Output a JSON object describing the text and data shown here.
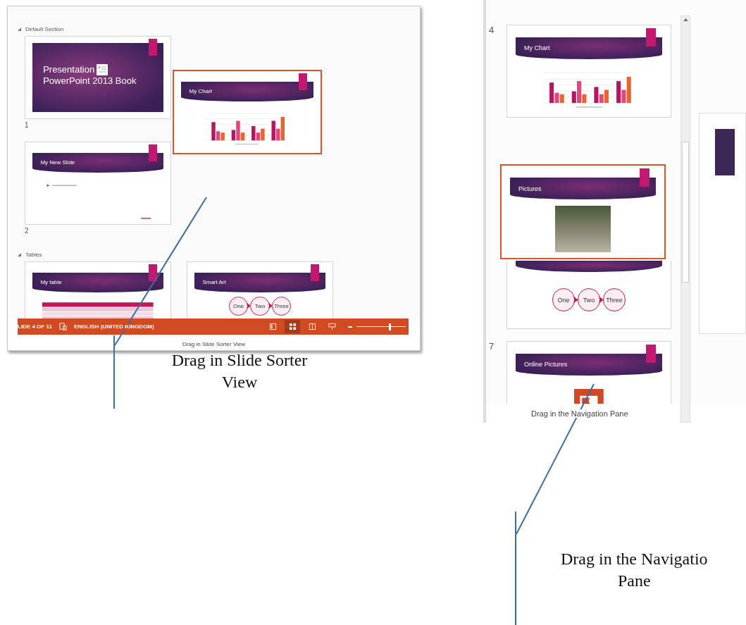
{
  "slide_sorter": {
    "sections": [
      {
        "label": "Default Section",
        "expanded": true,
        "slides": [
          {
            "number": "1",
            "kind": "title",
            "title_lines": [
              "Presentation",
              "PowerPoint 2013 Book"
            ]
          },
          {
            "number": "2",
            "kind": "bullets",
            "title": "My New Slide"
          }
        ]
      },
      {
        "label": "Tables",
        "expanded": true,
        "slides": [
          {
            "kind": "table",
            "title": "My table"
          },
          {
            "kind": "smartart",
            "title": "Smart Art",
            "steps": [
              "One",
              "Two",
              "Three"
            ]
          }
        ]
      }
    ],
    "dragged_slide": {
      "kind": "chart",
      "title": "My Chart"
    },
    "status_bar": {
      "slide_indicator": "LIDE 4 OF 11",
      "language": "ENGLISH (UNITED KINGDOM)",
      "views": [
        {
          "kind": "normal",
          "selected": false
        },
        {
          "kind": "sorter",
          "selected": true
        },
        {
          "kind": "reading",
          "selected": false
        },
        {
          "kind": "slideshow",
          "selected": false
        }
      ],
      "zoom": {
        "level": 0.65
      }
    },
    "caption": "Drag in Slide Sorter View"
  },
  "navigation_pane": {
    "slides": [
      {
        "number": "4",
        "kind": "chart",
        "title": "My Chart"
      },
      {
        "kind": "smartart",
        "steps": [
          "One",
          "Two",
          "Three"
        ]
      },
      {
        "number": "7",
        "kind": "icon",
        "title": "Online Pictures"
      }
    ],
    "dragged_slide": {
      "kind": "photo",
      "title": "Pictures"
    },
    "caption": "Drag in the Navigation Pane"
  },
  "figure_captions": [
    {
      "lines": [
        "Drag in Slide Sorter",
        "View"
      ]
    },
    {
      "lines": [
        "Drag in the Navigatio",
        "Pane"
      ]
    }
  ]
}
